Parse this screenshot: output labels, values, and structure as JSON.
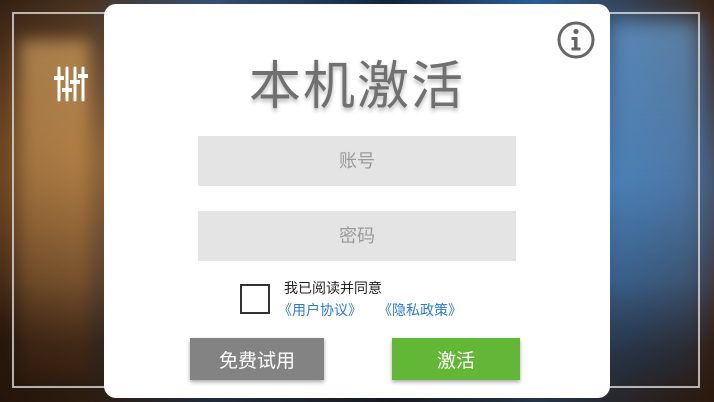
{
  "login": {
    "title": "本机激活",
    "account_placeholder": "账号",
    "password_placeholder": "密码",
    "agree_text": "我已阅读并同意",
    "user_agreement_link": "《用户协议》",
    "privacy_policy_link": "《隐私政策》",
    "trial_button": "免费试用",
    "activate_button": "激活"
  },
  "icons": {
    "settings": "equalizer-sliders-icon",
    "info": "info-circle-icon"
  },
  "colors": {
    "activate_green": "#62b737",
    "trial_gray": "#838383",
    "link_blue": "#2a7bd4",
    "field_gray": "#e4e4e4",
    "title_gray": "#707070"
  }
}
